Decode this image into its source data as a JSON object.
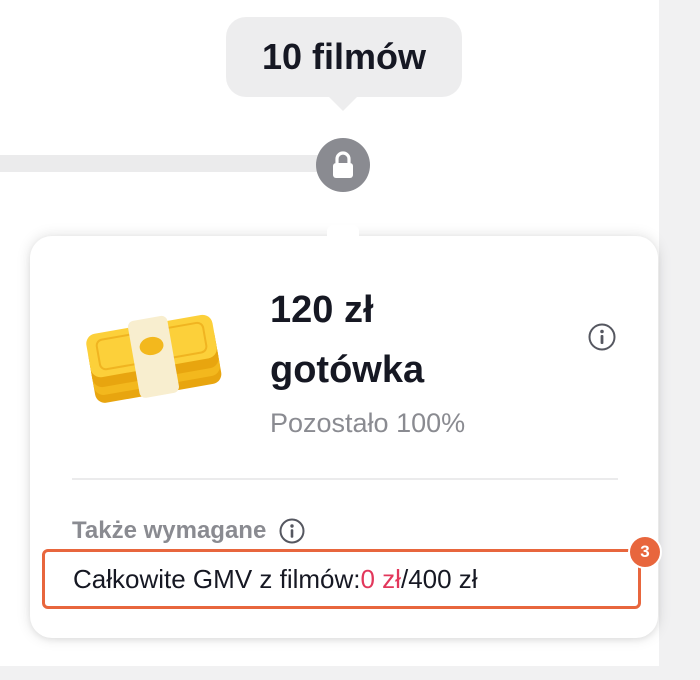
{
  "milestone": {
    "label": "10 filmów",
    "locked": true
  },
  "reward": {
    "title_line1": "120 zł",
    "title_line2": "gotówka",
    "remaining": "Pozostało 100%"
  },
  "requirements": {
    "heading": "Także wymagane",
    "gmv_label": "Całkowite GMV z filmów: ",
    "gmv_current": "0 zł",
    "gmv_target": "/400 zł"
  },
  "step_badge": "3",
  "icons": {
    "lock": "lock-icon",
    "info": "info-icon",
    "money": "cash-stack-icon"
  },
  "colors": {
    "accent_orange": "#e8663d",
    "progress_red": "#e2375b",
    "text_primary": "#161823",
    "text_secondary": "#8a8b91"
  }
}
